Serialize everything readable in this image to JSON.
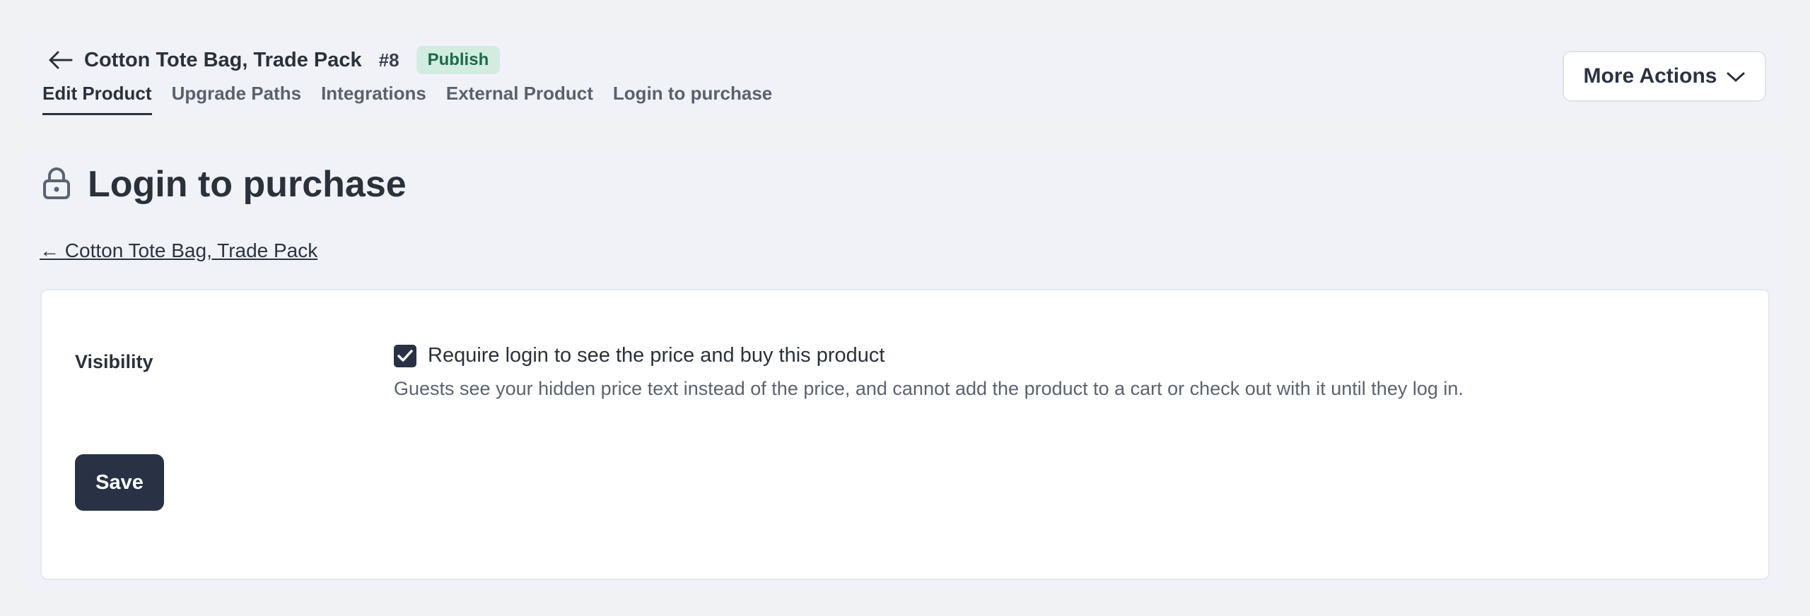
{
  "header": {
    "product_title": "Cotton Tote Bag, Trade Pack",
    "product_id": "#8",
    "status_badge": "Publish",
    "more_actions_label": "More Actions",
    "tabs": [
      {
        "label": "Edit Product",
        "active": true
      },
      {
        "label": "Upgrade Paths",
        "active": false
      },
      {
        "label": "Integrations",
        "active": false
      },
      {
        "label": "External Product",
        "active": false
      },
      {
        "label": "Login to purchase",
        "active": false
      }
    ]
  },
  "page": {
    "title": "Login to purchase",
    "back_link": "← Cotton Tote Bag, Trade Pack",
    "icon": "lock-icon"
  },
  "form": {
    "visibility_label": "Visibility",
    "require_login_label": "Require login to see the price and buy this product",
    "require_login_checked": true,
    "help_text": "Guests see your hidden price text instead of the price, and cannot add the product to a cart or check out with it until they log in.",
    "save_label": "Save"
  },
  "colors": {
    "badge_bg": "#d3ece1",
    "badge_text": "#1b6b4b",
    "primary_button": "#283244"
  }
}
